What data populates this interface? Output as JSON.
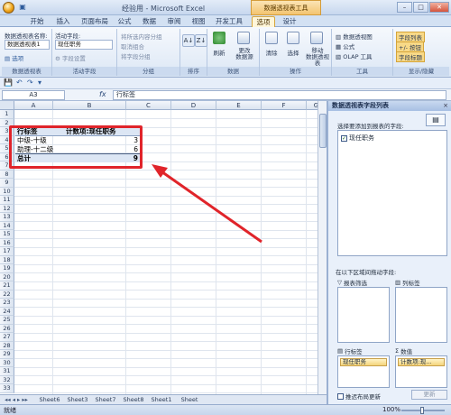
{
  "window": {
    "title": "经验用 - Microsoft Excel",
    "tools_tag": "数据透视表工具"
  },
  "tabs": [
    {
      "label": "开始",
      "active": false
    },
    {
      "label": "插入",
      "active": false
    },
    {
      "label": "页面布局",
      "active": false
    },
    {
      "label": "公式",
      "active": false
    },
    {
      "label": "数据",
      "active": false
    },
    {
      "label": "审阅",
      "active": false
    },
    {
      "label": "视图",
      "active": false
    },
    {
      "label": "开发工具",
      "active": false
    },
    {
      "label": "选项",
      "active": true
    },
    {
      "label": "设计",
      "active": false
    }
  ],
  "ribbon": {
    "pivot_name_label": "数据透视表名称:",
    "pivot_name_value": "数据透视表1",
    "options_label": "选项",
    "group_pivot": "数据透视表",
    "active_field_label": "活动字段:",
    "active_field_value": "现任职务",
    "field_settings": "字段设置",
    "group_active_field": "活动字段",
    "group_selection": "将所选内容分组",
    "ungroup": "取消组合",
    "group_field": "将字段分组",
    "group_group": "分组",
    "group_sort": "排序",
    "refresh": "刷新",
    "change_source": "更改\n数据源",
    "group_data": "数据",
    "clear": "清除",
    "select": "选择",
    "move": "移动\n数据透视表",
    "group_actions": "操作",
    "pivot_chart": "数据透视图",
    "formula": "公式",
    "olap": "OLAP 工具",
    "group_tools": "工具",
    "field_list": "字段列表",
    "plus_minus": "+/- 按钮",
    "field_headers": "字段标题",
    "group_show": "显示/隐藏"
  },
  "formula_bar": {
    "name_box": "A3",
    "fx": "fx",
    "value": "行标签"
  },
  "grid": {
    "columns": [
      "A",
      "B",
      "C",
      "D",
      "E",
      "F",
      "G"
    ],
    "rows": [
      "1",
      "2",
      "3",
      "4",
      "5",
      "6",
      "7",
      "8",
      "9",
      "10",
      "11",
      "12",
      "13",
      "14",
      "15",
      "16",
      "17",
      "18",
      "19",
      "20",
      "21",
      "22",
      "23",
      "24",
      "25",
      "26",
      "27",
      "28",
      "29",
      "30",
      "31",
      "32",
      "33"
    ]
  },
  "pivot_table": {
    "header_row_label": "行标签",
    "header_value_label": "计数项:现任职务",
    "rows": [
      {
        "label": "中级-十级",
        "value": "3"
      },
      {
        "label": "助理-十二级",
        "value": "6"
      }
    ],
    "total_label": "总计",
    "total_value": "9"
  },
  "sheet_tabs": [
    "Sheet6",
    "Sheet3",
    "Sheet7",
    "Sheet8",
    "Sheet1",
    "Sheet"
  ],
  "status": {
    "ready": "就绪",
    "zoom": "100%"
  },
  "field_panel": {
    "title": "数据透视表字段列表",
    "close": "×",
    "choose_label": "选择要添加到报表的字段:",
    "fields": [
      {
        "label": "现任职务",
        "checked": true
      }
    ],
    "drag_label": "在以下区域间拖动字段:",
    "report_filter": "报表筛选",
    "column_labels": "列标签",
    "row_labels": "行标签",
    "values": "数值",
    "row_item": "现任职务",
    "value_item": "计数项:现...",
    "defer_label": "推迟布局更新",
    "update": "更新"
  },
  "colors": {
    "highlight": "#e0242a",
    "accent": "#f3c470"
  }
}
